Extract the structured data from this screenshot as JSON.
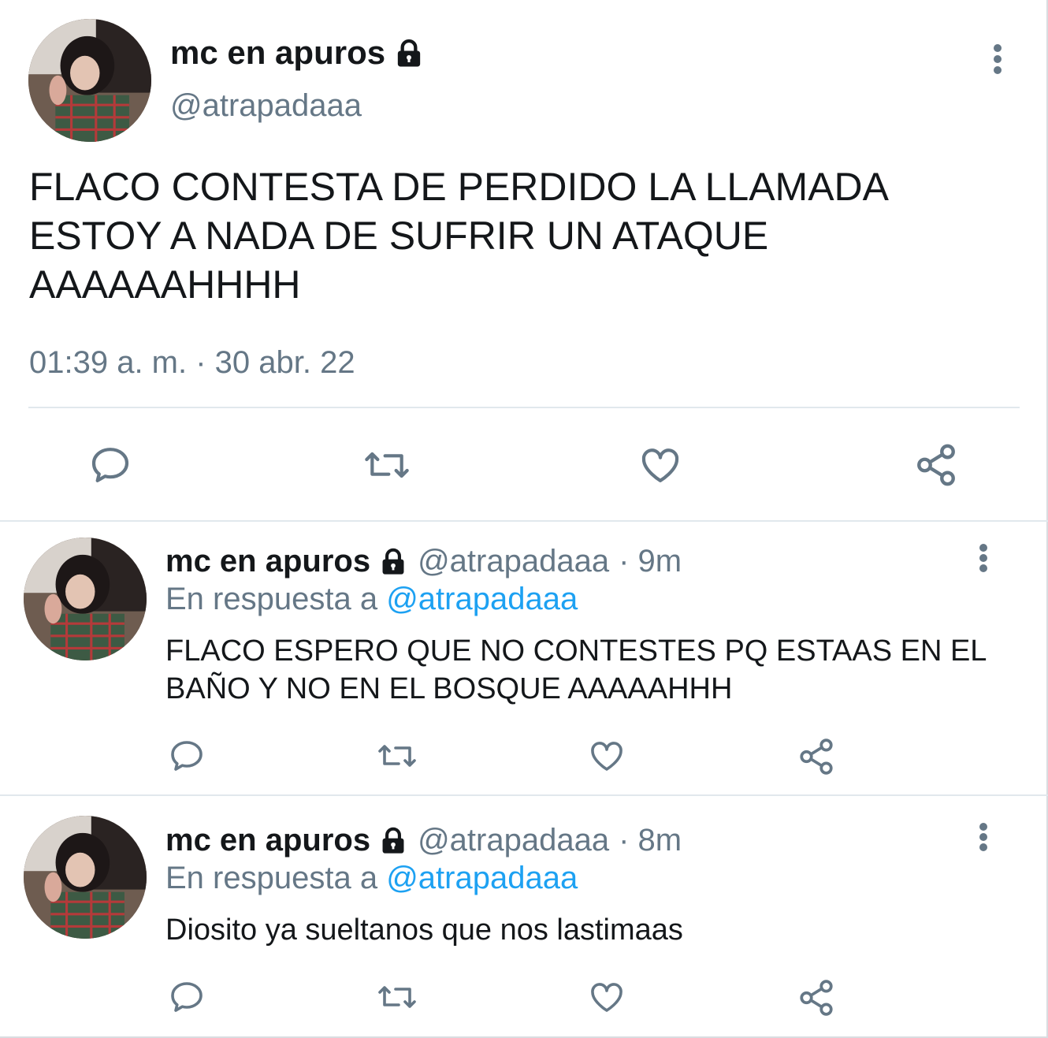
{
  "main_tweet": {
    "display_name": "mc en apuros",
    "handle": "@atrapadaaa",
    "text_lines": [
      "FLACO CONTESTA DE PERDIDO LA LLAMADA",
      "ESTOY A NADA DE SUFRIR UN ATAQUE",
      "AAAAAAHHHH"
    ],
    "timestamp": "01:39 a. m. · 30 abr. 22",
    "lock_icon": "lock-icon",
    "more_icon": "more-vertical-icon",
    "actions": [
      "reply-icon",
      "retweet-icon",
      "like-icon",
      "share-icon"
    ]
  },
  "replies": [
    {
      "display_name": "mc en apuros",
      "handle": "@atrapadaaa",
      "time": "· 9m",
      "reply_prefix": "En respuesta a",
      "reply_to": "@atrapadaaa",
      "text_lines": [
        "FLACO ESPERO QUE NO CONTESTES PQ ESTAAS EN EL",
        "BAÑO Y NO EN EL BOSQUE AAAAAHHH"
      ]
    },
    {
      "display_name": "mc en apuros",
      "handle": "@atrapadaaa",
      "time": "· 8m",
      "reply_prefix": "En respuesta a",
      "reply_to": "@atrapadaaa",
      "text_lines": [
        "Diosito ya sueltanos que nos lastimaas"
      ]
    }
  ],
  "colors": {
    "text": "#14171a",
    "secondary": "#657786",
    "link": "#1da1f2",
    "divider": "#e1e8ed"
  }
}
